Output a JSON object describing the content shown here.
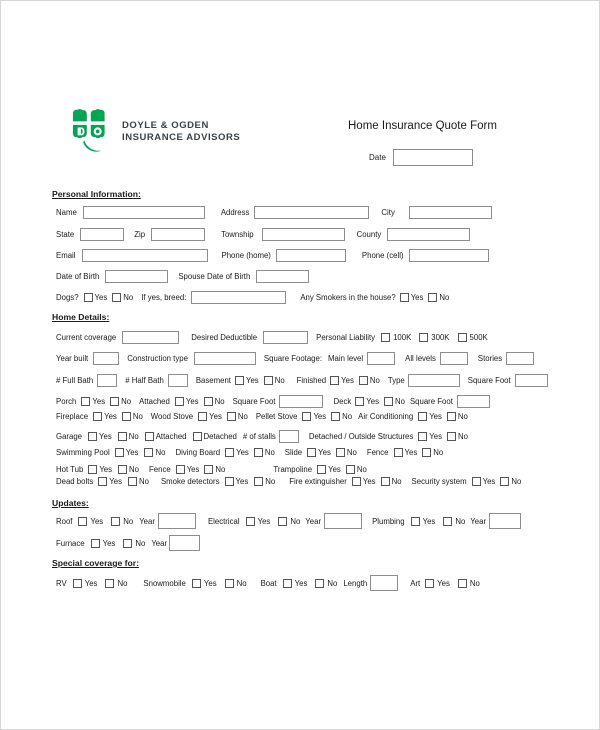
{
  "brand": {
    "logo_icon": "clover-do-logo",
    "name_line1": "DOYLE & OGDEN",
    "name_line2": "INSURANCE ADVISORS",
    "green": "#00a651"
  },
  "header": {
    "title": "Home Insurance Quote Form",
    "date_label": "Date",
    "date_value": ""
  },
  "common": {
    "yes": "Yes",
    "no": "No"
  },
  "personal": {
    "heading": "Personal Information:",
    "name_label": "Name",
    "name_value": "",
    "address_label": "Address",
    "address_value": "",
    "city_label": "City",
    "city_value": "",
    "state_label": "State",
    "state_value": "",
    "zip_label": "Zip",
    "zip_value": "",
    "township_label": "Township",
    "township_value": "",
    "county_label": "County",
    "county_value": "",
    "email_label": "Email",
    "email_value": "",
    "phone_home_label": "Phone (home)",
    "phone_home_value": "",
    "phone_cell_label": "Phone (cell)",
    "phone_cell_value": "",
    "dob_label": "Date of Birth",
    "dob_value": "",
    "spouse_dob_label": "Spouse Date of Birth",
    "spouse_dob_value": "",
    "dogs_label": "Dogs?",
    "breed_label": "If yes, breed:",
    "breed_value": "",
    "smokers_label": "Any Smokers in the house?"
  },
  "home": {
    "heading": "Home Details:",
    "current_coverage_label": "Current coverage",
    "current_coverage_value": "",
    "desired_deductible_label": "Desired Deductible",
    "desired_deductible_value": "",
    "personal_liability_label": "Personal Liability",
    "liability_options": [
      "100K",
      "300K",
      "500K"
    ],
    "year_built_label": "Year built",
    "year_built_value": "",
    "construction_type_label": "Construction type",
    "construction_type_value": "",
    "square_footage_label": "Square Footage:",
    "main_level_label": "Main level",
    "main_level_value": "",
    "all_levels_label": "All levels",
    "all_levels_value": "",
    "stories_label": "Stories",
    "stories_value": "",
    "full_bath_label": "# Full Bath",
    "full_bath_value": "",
    "half_bath_label": "# Half Bath",
    "half_bath_value": "",
    "basement_label": "Basement",
    "finished_label": "Finished",
    "type_label": "Type",
    "type_value": "",
    "basement_sqft_label": "Square Foot",
    "basement_sqft_value": "",
    "porch_label": "Porch",
    "attached_label": "Attached",
    "porch_sqft_label": "Square Foot",
    "porch_sqft_value": "",
    "deck_label": "Deck",
    "deck_sqft_label": "Square Foot",
    "deck_sqft_value": "",
    "fireplace_label": "Fireplace",
    "wood_stove_label": "Wood Stove",
    "pellet_stove_label": "Pellet Stove",
    "air_conditioning_label": "Air Conditioning",
    "garage_label": "Garage",
    "garage_attached_label": "Attached",
    "garage_detached_label": "Detached",
    "stalls_label": "# of stalls",
    "stalls_value": "",
    "outside_structures_label": "Detached / Outside Structures",
    "swimming_pool_label": "Swimming Pool",
    "diving_board_label": "Diving Board",
    "slide_label": "Slide",
    "pool_fence_label": "Fence",
    "hot_tub_label": "Hot Tub",
    "fence_label": "Fence",
    "trampoline_label": "Trampoline",
    "dead_bolts_label": "Dead bolts",
    "smoke_detectors_label": "Smoke detectors",
    "fire_extinguisher_label": "Fire extinguisher",
    "security_system_label": "Security system"
  },
  "updates": {
    "heading": "Updates:",
    "year_label": "Year",
    "roof_label": "Roof",
    "roof_year_value": "",
    "electrical_label": "Electrical",
    "electrical_year_value": "",
    "plumbing_label": "Plumbing",
    "plumbing_year_value": "",
    "furnace_label": "Furnace",
    "furnace_year_value": ""
  },
  "special": {
    "heading": "Special coverage for:",
    "rv_label": "RV",
    "snowmobile_label": "Snowmobile",
    "boat_label": "Boat",
    "length_label": "Length",
    "length_value": "",
    "art_label": "Art"
  }
}
